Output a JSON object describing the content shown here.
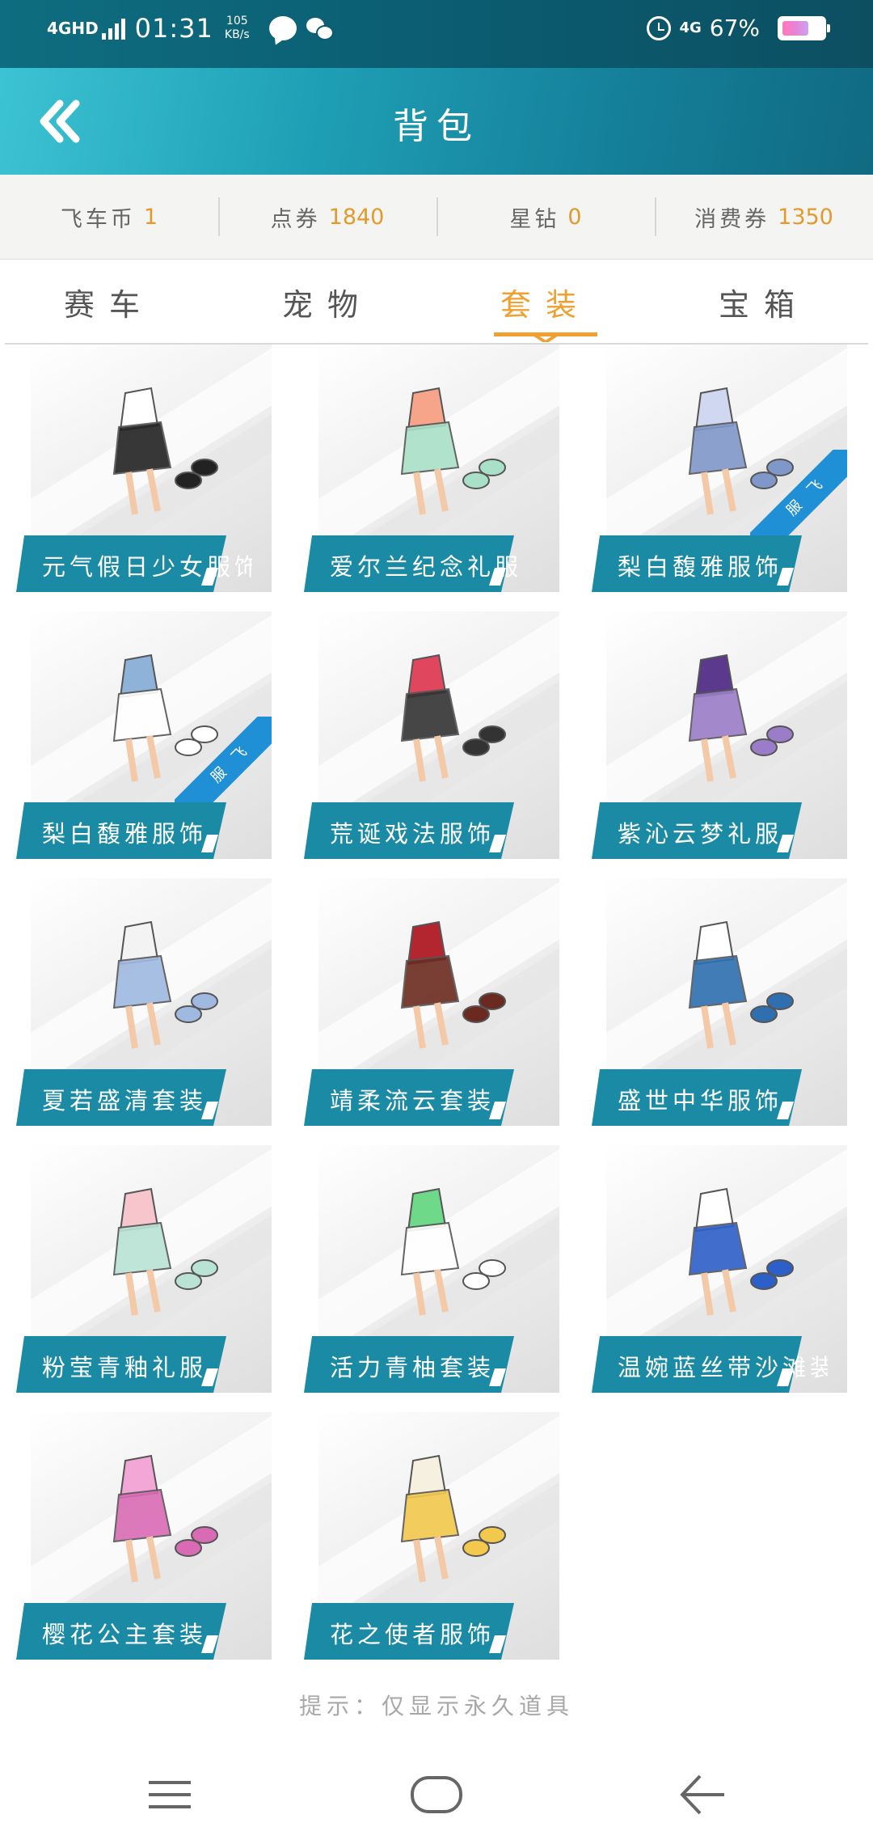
{
  "status_bar": {
    "network": "4GHD",
    "time": "01:31",
    "speed_value": "105",
    "speed_unit": "KB/s",
    "mobile_type": "4G",
    "battery": "67%"
  },
  "header": {
    "title": "背包"
  },
  "currency": [
    {
      "label": "飞车币",
      "value": "1"
    },
    {
      "label": "点券",
      "value": "1840"
    },
    {
      "label": "星钻",
      "value": "0"
    },
    {
      "label": "消费券",
      "value": "1350"
    }
  ],
  "tabs": [
    {
      "label": "赛车",
      "active": false
    },
    {
      "label": "宠物",
      "active": false
    },
    {
      "label": "套装",
      "active": true
    },
    {
      "label": "宝箱",
      "active": false
    }
  ],
  "items": [
    {
      "name": "元气假日少女服饰",
      "color": "#ffffff",
      "accent": "#222222",
      "badge": false
    },
    {
      "name": "爱尔兰纪念礼服",
      "color": "#f7a58a",
      "accent": "#a8e0c8",
      "badge": false
    },
    {
      "name": "梨白馥雅服饰",
      "color": "#cfd8f0",
      "accent": "#7f97c9",
      "badge": true,
      "badge_text": "服 飞"
    },
    {
      "name": "梨白馥雅服饰",
      "color": "#8fb2d8",
      "accent": "#ffffff",
      "badge": true,
      "badge_text": "服 飞"
    },
    {
      "name": "荒诞戏法服饰",
      "color": "#e0475e",
      "accent": "#333333",
      "badge": false
    },
    {
      "name": "紫沁云梦礼服",
      "color": "#5b3a8e",
      "accent": "#9a7cc8",
      "badge": false
    },
    {
      "name": "夏若盛清套装",
      "color": "#f3f3f3",
      "accent": "#9fb9e0",
      "badge": false
    },
    {
      "name": "靖柔流云套装",
      "color": "#b3262f",
      "accent": "#6b2a1f",
      "badge": false
    },
    {
      "name": "盛世中华服饰",
      "color": "#ffffff",
      "accent": "#2f6fb0",
      "badge": false
    },
    {
      "name": "粉莹青釉礼服",
      "color": "#f6c6cc",
      "accent": "#b9e3d5",
      "badge": false
    },
    {
      "name": "活力青柚套装",
      "color": "#6fd98a",
      "accent": "#ffffff",
      "badge": false
    },
    {
      "name": "温婉蓝丝带沙滩装",
      "color": "#ffffff",
      "accent": "#2d5fc8",
      "badge": false
    },
    {
      "name": "樱花公主套装",
      "color": "#f2a7d6",
      "accent": "#d96bb5",
      "badge": false
    },
    {
      "name": "花之使者服饰",
      "color": "#f5f0e0",
      "accent": "#f2c94c",
      "badge": false
    }
  ],
  "hint": "提示：仅显示永久道具",
  "colors": {
    "accent_orange": "#f0a030",
    "label_teal": "#1b8aa4",
    "header_teal": "#1fa0b6"
  },
  "icons": {
    "back": "double-chevron-left-icon",
    "nav_menu": "menu-icon",
    "nav_home": "home-icon",
    "nav_back": "back-arrow-icon"
  }
}
